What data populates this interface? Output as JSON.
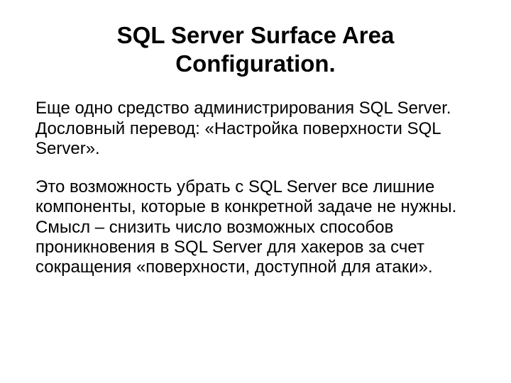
{
  "title": "SQL Server Surface Area Configuration.",
  "paragraph1": "Еще одно средство администрирования SQL Server. Дословный перевод: «Настройка поверхности SQL Server».",
  "paragraph2": "Это возможность убрать с SQL Server все лишние компоненты, которые в конкретной задаче не нужны.\nСмысл – снизить число возможных способов проникновения в SQL Server для хакеров за счет сокращения «поверхности, доступной для атаки»."
}
